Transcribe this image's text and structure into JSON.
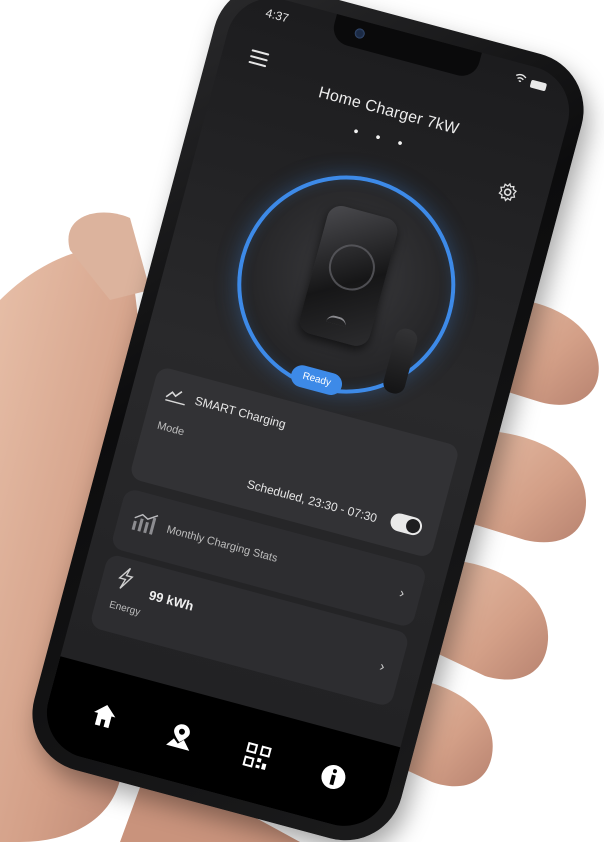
{
  "status_bar": {
    "time": "4:37"
  },
  "header": {
    "title": "Home Charger 7kW",
    "page_indicator": "• • •"
  },
  "charger": {
    "state_badge": "Ready",
    "accent_color": "#3d8ae8"
  },
  "smart_charging": {
    "title": "SMART Charging",
    "mode_label": "Mode",
    "schedule": "Scheduled, 23:30 - 07:30",
    "toggle_on": true
  },
  "stats": {
    "title": "Monthly Charging Stats"
  },
  "energy": {
    "value": "99 kWh",
    "label": "Energy"
  },
  "nav": {
    "items": [
      "home-icon",
      "map-pin-icon",
      "qr-code-icon",
      "info-icon"
    ]
  }
}
